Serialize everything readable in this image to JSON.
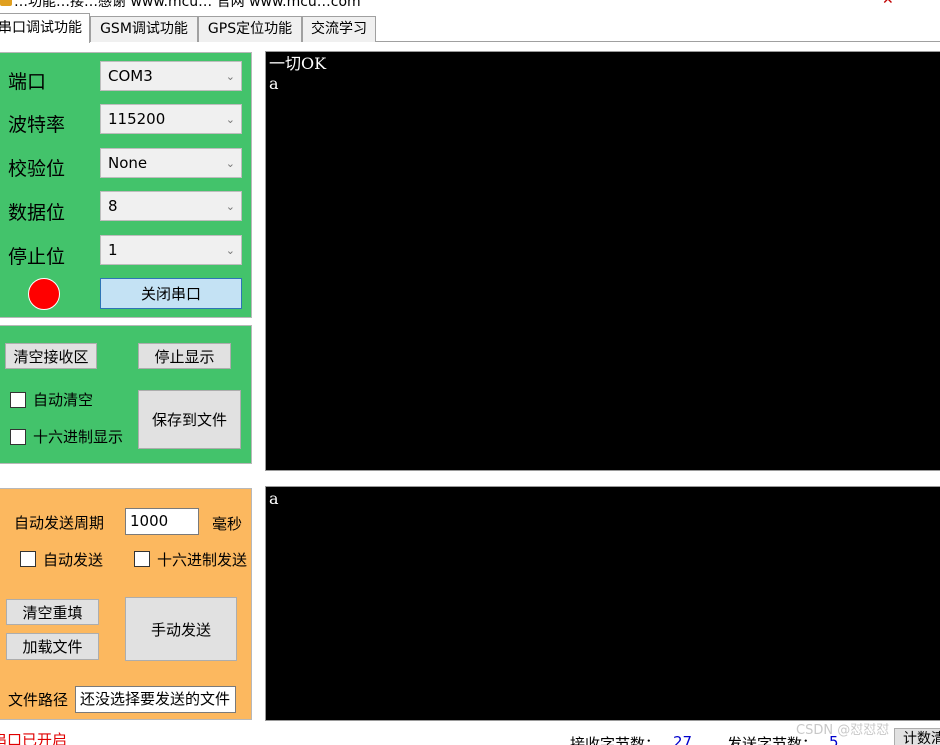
{
  "window": {
    "title": "…功能…接…感谢 www.mcu…  官网  www.mcu…com",
    "close_glyph": "✕"
  },
  "tabs": [
    {
      "label": "串口调试功能",
      "active": true
    },
    {
      "label": "GSM调试功能",
      "active": false
    },
    {
      "label": "GPS定位功能",
      "active": false
    },
    {
      "label": "交流学习",
      "active": false
    }
  ],
  "serial_config": {
    "port": {
      "label": "端口",
      "value": "COM3"
    },
    "baud": {
      "label": "波特率",
      "value": "115200"
    },
    "parity": {
      "label": "校验位",
      "value": "None"
    },
    "databits": {
      "label": "数据位",
      "value": "8"
    },
    "stopbits": {
      "label": "停止位",
      "value": "1"
    },
    "status_led_color": "#ff0000",
    "close_port_label": "关闭串口"
  },
  "receive_controls": {
    "clear_label": "清空接收区",
    "stop_label": "停止显示",
    "auto_clear_label": "自动清空",
    "hex_display_label": "十六进制显示",
    "save_label": "保存到文件"
  },
  "send_controls": {
    "period_label": "自动发送周期",
    "period_value": "1000",
    "period_unit": "毫秒",
    "auto_send_label": "自动发送",
    "hex_send_label": "十六进制发送",
    "clear_label": "清空重填",
    "load_label": "加载文件",
    "manual_send_label": "手动发送",
    "file_path_label": "文件路径",
    "file_path_value": "还没选择要发送的文件"
  },
  "receive_area": {
    "text": "一切OK\na"
  },
  "send_area": {
    "text": "a"
  },
  "status_bar": {
    "port_status": "串口已开启",
    "rx_label": "接收字节数：",
    "rx_value": "27",
    "tx_label": "发送字节数：",
    "tx_value": "5",
    "reset_label": "计数清",
    "watermark": "CSDN @怼怼怼"
  },
  "colors": {
    "green_panel": "#43c36b",
    "orange_panel": "#fcb85f",
    "terminal_bg": "#000000",
    "status_red": "#e00000",
    "count_blue": "#0000cc"
  }
}
